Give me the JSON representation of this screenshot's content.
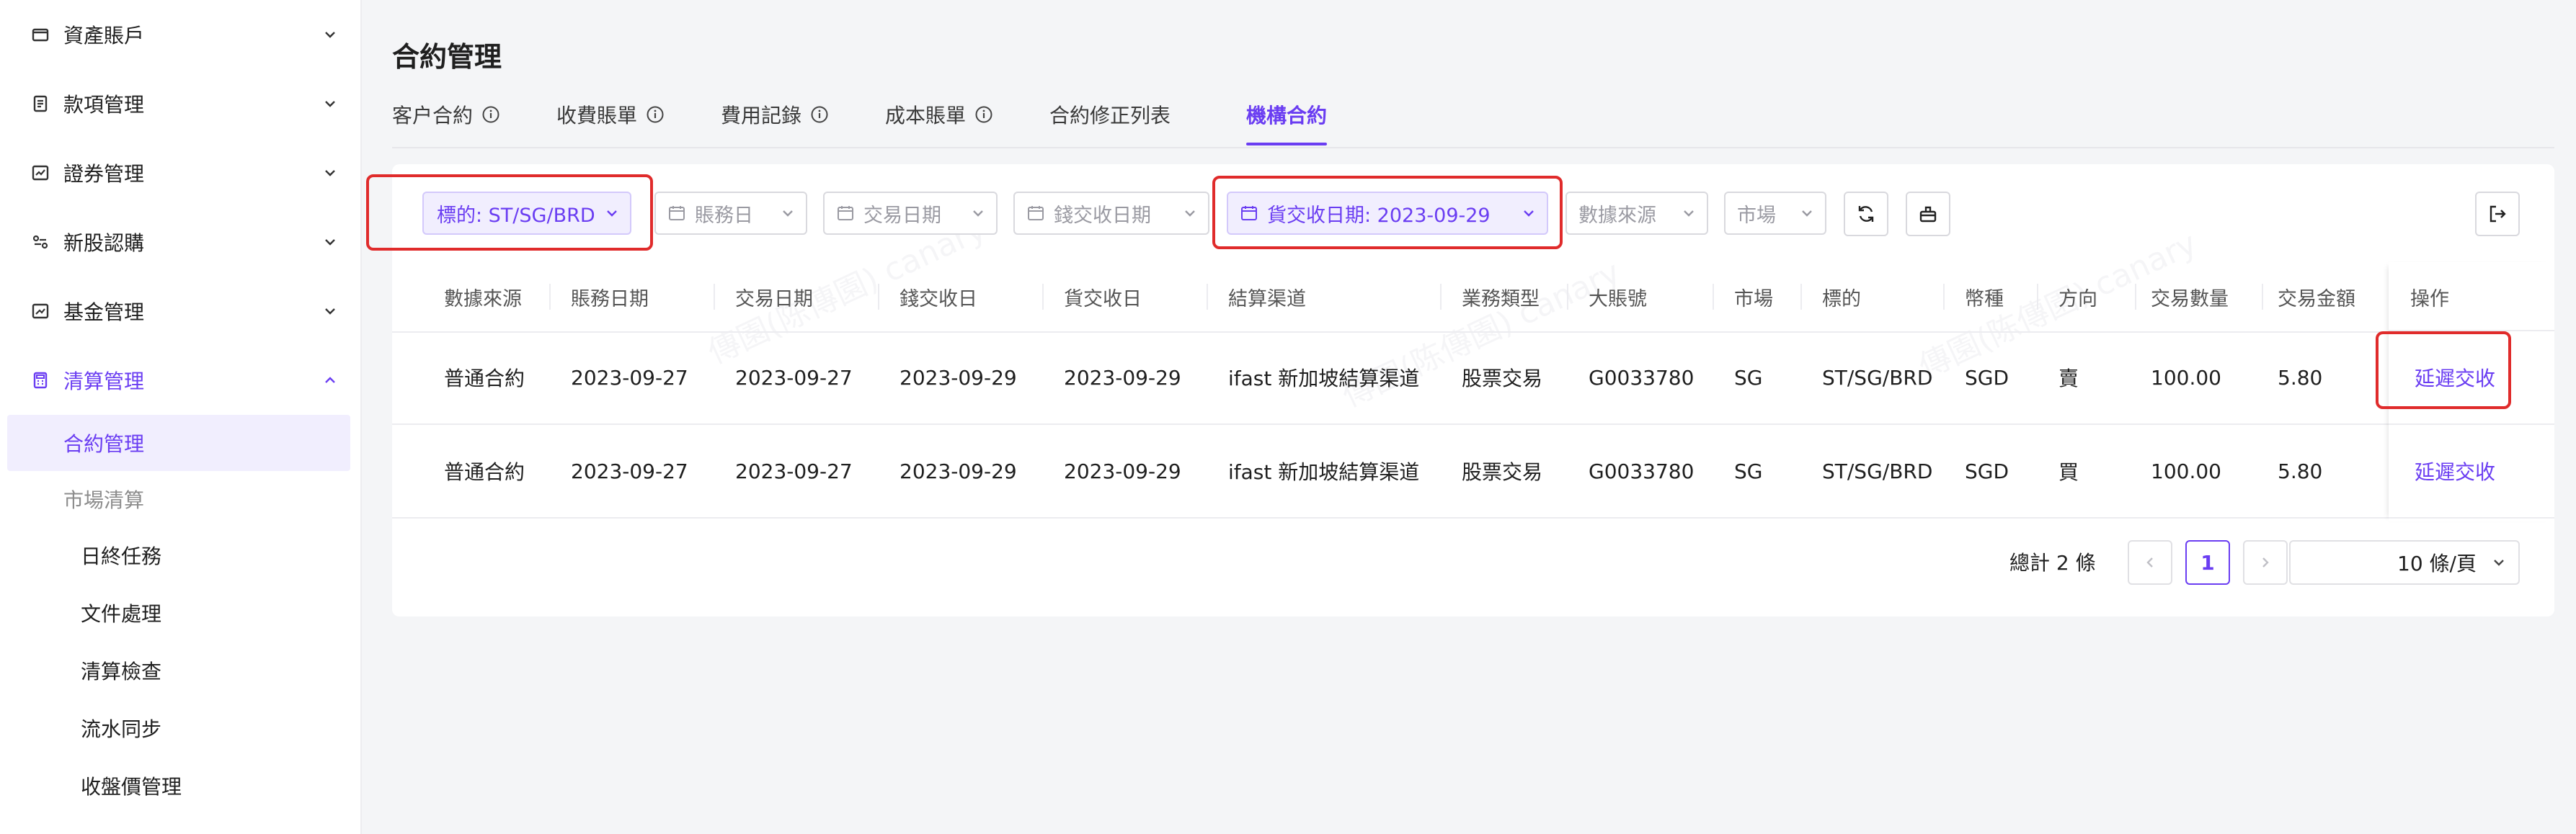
{
  "colors": {
    "accent": "#6a3df2",
    "highlight": "#e02b2b"
  },
  "sidebar": {
    "groups": [
      {
        "label": "資產賬戶",
        "icon": "wallet-icon"
      },
      {
        "label": "款項管理",
        "icon": "receipt-icon"
      },
      {
        "label": "證券管理",
        "icon": "stock-chart-icon"
      },
      {
        "label": "新股認購",
        "icon": "ipo-icon"
      },
      {
        "label": "基金管理",
        "icon": "trend-chart-icon"
      },
      {
        "label": "清算管理",
        "icon": "calculator-icon"
      }
    ],
    "sub": [
      {
        "label": "合約管理"
      },
      {
        "label": "市場清算"
      },
      {
        "label": "日終任務"
      },
      {
        "label": "文件處理"
      },
      {
        "label": "清算檢查"
      },
      {
        "label": "流水同步"
      },
      {
        "label": "收盤價管理"
      }
    ]
  },
  "page": {
    "title": "合約管理"
  },
  "tabs": [
    "客户合約",
    "收費賬單",
    "費用記錄",
    "成本賬單",
    "合約修正列表",
    "機構合約"
  ],
  "filters": {
    "underlying": "標的: ST/SG/BRD",
    "account_date": "賬務日",
    "trade_date": "交易日期",
    "cash_settle_date": "錢交收日期",
    "goods_settle_date": "貨交收日期: 2023-09-29",
    "data_source": "數據來源",
    "market": "市場"
  },
  "table": {
    "columns": [
      "數據來源",
      "賬務日期",
      "交易日期",
      "錢交收日",
      "貨交收日",
      "結算渠道",
      "業務類型",
      "大賬號",
      "市場",
      "標的",
      "幣種",
      "方向",
      "交易數量",
      "交易金額"
    ],
    "op_header": "操作",
    "rows": [
      {
        "cells": [
          "普通合約",
          "2023-09-27",
          "2023-09-27",
          "2023-09-29",
          "2023-09-29",
          "ifast 新加坡結算渠道",
          "股票交易",
          "G0033780",
          "SG",
          "ST/SG/BRD",
          "SGD",
          "賣",
          "100.00",
          "5.80"
        ],
        "action": "延遲交收"
      },
      {
        "cells": [
          "普通合約",
          "2023-09-27",
          "2023-09-27",
          "2023-09-29",
          "2023-09-29",
          "ifast 新加坡結算渠道",
          "股票交易",
          "G0033780",
          "SG",
          "ST/SG/BRD",
          "SGD",
          "買",
          "100.00",
          "5.80"
        ],
        "action": "延遲交收"
      }
    ]
  },
  "pagination": {
    "total": "總計 2 條",
    "current_page": "1",
    "page_size": "10 條/頁"
  },
  "watermark": "傳園(陈傳園) canary"
}
